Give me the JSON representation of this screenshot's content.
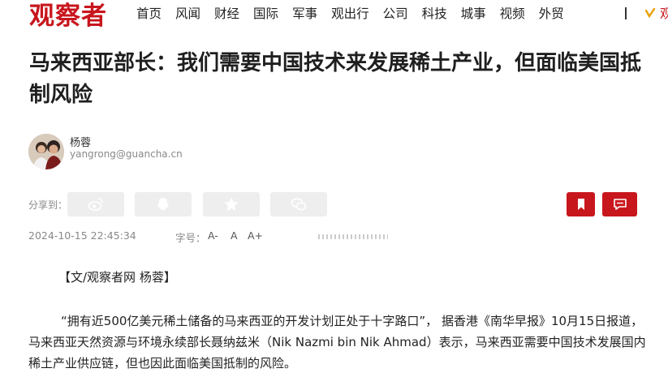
{
  "header": {
    "logo": "观察者",
    "nav": [
      "首页",
      "风闻",
      "财经",
      "国际",
      "军事",
      "观出行",
      "公司",
      "科技",
      "城事",
      "视频",
      "外贸"
    ],
    "nav_extra": "观"
  },
  "article": {
    "title": "马来西亚部长：我们需要中国技术来发展稀土产业，但面临美国抵制风险",
    "author": {
      "name": "杨蓉",
      "email": "yangrong@guancha.cn"
    },
    "share_label": "分享到：",
    "share_icons": [
      "weibo-icon",
      "qq-icon",
      "star-icon",
      "wechat-icon"
    ],
    "action_icons": [
      "bookmark-icon",
      "comment-icon"
    ],
    "date": "2024-10-15 22:45:34",
    "font_size_label": "字号：",
    "font_size_options": [
      "A-",
      "A",
      "A+"
    ],
    "source": "【文/观察者网 杨蓉】",
    "paragraph": "“拥有近500亿美元稀土储备的马来西亚的开发计划正处于十字路口”， 据香港《南华早报》10月15日报道，马来西亚天然资源与环境永续部长聂纳兹米（Nik Nazmi bin Nik Ahmad）表示，马来西亚需要中国技术发展国内稀土产业供应链，但也因此面临美国抵制的风险。"
  },
  "colors": {
    "brand": "#c8161d",
    "share_bg": "#eeeeee",
    "muted": "#888888"
  }
}
